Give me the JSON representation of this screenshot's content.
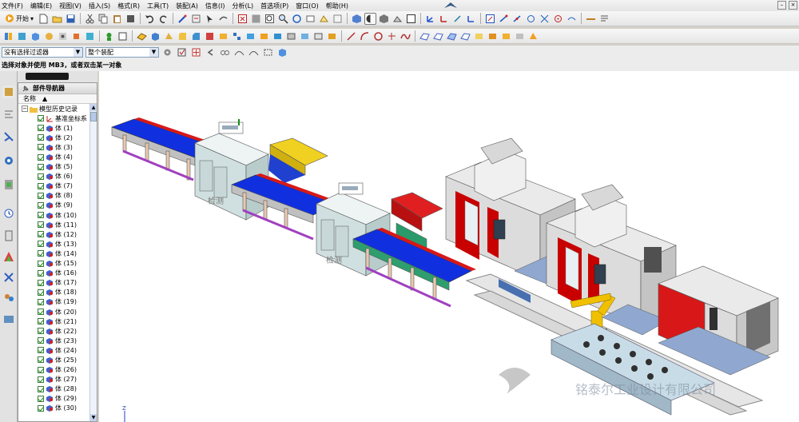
{
  "menubar": {
    "items": [
      "文件(F)",
      "编辑(E)",
      "视图(V)",
      "插入(S)",
      "格式(R)",
      "工具(T)",
      "装配(A)",
      "信息(I)",
      "分析(L)",
      "首选项(P)",
      "窗口(O)",
      "帮助(H)"
    ]
  },
  "toolbar": {
    "start_label": "开始"
  },
  "selection": {
    "filter_value": "没有选择过滤器",
    "scope_value": "整个装配"
  },
  "cue_line": "选择对象并使用 MB3，或者双击某一对象",
  "navigator": {
    "title": "部件导航器",
    "column_name": "名称",
    "sort_glyph": "▲",
    "history_node": "模型历史记录",
    "datum_node": "基准坐标系",
    "bodies": [
      "体 (1)",
      "体 (2)",
      "体 (3)",
      "体 (4)",
      "体 (5)",
      "体 (6)",
      "体 (7)",
      "体 (8)",
      "体 (9)",
      "体 (10)",
      "体 (11)",
      "体 (12)",
      "体 (13)",
      "体 (14)",
      "体 (15)",
      "体 (16)",
      "体 (17)",
      "体 (18)",
      "体 (19)",
      "体 (20)",
      "体 (21)",
      "体 (22)",
      "体 (23)",
      "体 (24)",
      "体 (25)",
      "体 (26)",
      "体 (27)",
      "体 (28)",
      "体 (29)",
      "体 (30)"
    ]
  },
  "viewport": {
    "station_label_1": "检测",
    "station_label_2": "检测",
    "axis_label": "Z",
    "watermark": "铭泰尔工业设计有限公司"
  },
  "colors": {
    "conveyor_top": "#1030e0",
    "conveyor_red": "#d81818",
    "machine_red": "#c80000",
    "robot_yellow": "#f0c000",
    "base_blue": "#7090c8"
  }
}
